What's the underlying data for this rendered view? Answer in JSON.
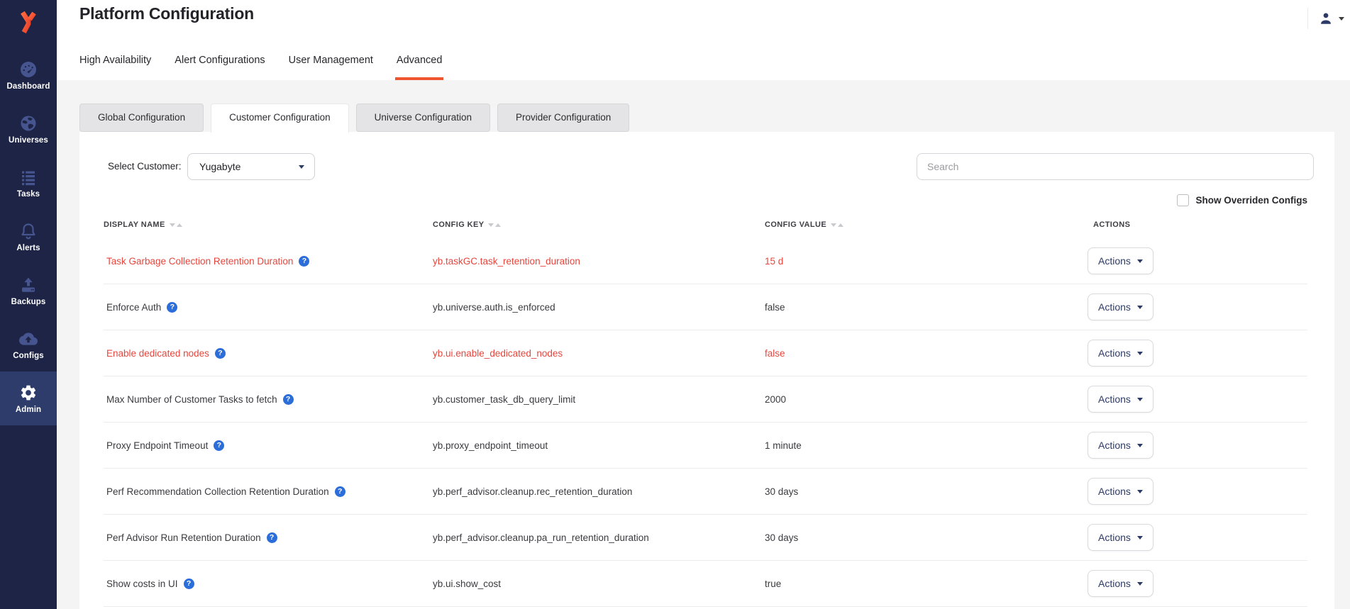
{
  "colors": {
    "sidebar_bg": "#1d2446",
    "sidebar_active_bg": "#2e3c6b",
    "sidebar_icon": "#46558f",
    "accent_orange": "#ef562f",
    "overridden_red": "#e8453c",
    "help_blue": "#2b6dd9",
    "text_dark": "#232329",
    "page_bg": "#f4f4f5",
    "navy": "#2d3b66"
  },
  "icons": {
    "help_glyph": "?"
  },
  "sidebar": {
    "items": [
      {
        "label": "Dashboard",
        "icon": "dashboard-gauge",
        "active": false
      },
      {
        "label": "Universes",
        "icon": "globe",
        "active": false
      },
      {
        "label": "Tasks",
        "icon": "task-list",
        "active": false
      },
      {
        "label": "Alerts",
        "icon": "bell",
        "active": false
      },
      {
        "label": "Backups",
        "icon": "backup-upload",
        "active": false
      },
      {
        "label": "Configs",
        "icon": "cloud-upload",
        "active": false
      },
      {
        "label": "Admin",
        "icon": "gear",
        "active": true
      }
    ]
  },
  "header": {
    "title": "Platform Configuration",
    "tabs": [
      {
        "label": "High Availability",
        "active": false
      },
      {
        "label": "Alert Configurations",
        "active": false
      },
      {
        "label": "User Management",
        "active": false
      },
      {
        "label": "Advanced",
        "active": true
      }
    ]
  },
  "subtabs": [
    {
      "label": "Global Configuration",
      "active": false
    },
    {
      "label": "Customer Configuration",
      "active": true
    },
    {
      "label": "Universe Configuration",
      "active": false
    },
    {
      "label": "Provider Configuration",
      "active": false
    }
  ],
  "controls": {
    "select_customer_label": "Select Customer:",
    "customer_value": "Yugabyte",
    "search_placeholder": "Search",
    "show_overridden_label": "Show Overriden Configs",
    "show_overridden_checked": false
  },
  "table": {
    "columns": [
      {
        "label": "DISPLAY NAME",
        "sortable": true
      },
      {
        "label": "CONFIG KEY",
        "sortable": true
      },
      {
        "label": "CONFIG VALUE",
        "sortable": true
      },
      {
        "label": "ACTIONS",
        "sortable": false
      }
    ],
    "rows": [
      {
        "display_name": "Task Garbage Collection Retention Duration",
        "config_key": "yb.taskGC.task_retention_duration",
        "config_value": "15 d",
        "overridden": true,
        "action_label": "Actions"
      },
      {
        "display_name": "Enforce Auth",
        "config_key": "yb.universe.auth.is_enforced",
        "config_value": "false",
        "overridden": false,
        "action_label": "Actions"
      },
      {
        "display_name": "Enable dedicated nodes",
        "config_key": "yb.ui.enable_dedicated_nodes",
        "config_value": "false",
        "overridden": true,
        "action_label": "Actions"
      },
      {
        "display_name": "Max Number of Customer Tasks to fetch",
        "config_key": "yb.customer_task_db_query_limit",
        "config_value": "2000",
        "overridden": false,
        "action_label": "Actions"
      },
      {
        "display_name": "Proxy Endpoint Timeout",
        "config_key": "yb.proxy_endpoint_timeout",
        "config_value": "1 minute",
        "overridden": false,
        "action_label": "Actions"
      },
      {
        "display_name": "Perf Recommendation Collection Retention Duration",
        "config_key": "yb.perf_advisor.cleanup.rec_retention_duration",
        "config_value": "30 days",
        "overridden": false,
        "action_label": "Actions"
      },
      {
        "display_name": "Perf Advisor Run Retention Duration",
        "config_key": "yb.perf_advisor.cleanup.pa_run_retention_duration",
        "config_value": "30 days",
        "overridden": false,
        "action_label": "Actions"
      },
      {
        "display_name": "Show costs in UI",
        "config_key": "yb.ui.show_cost",
        "config_value": "true",
        "overridden": false,
        "action_label": "Actions"
      }
    ]
  }
}
